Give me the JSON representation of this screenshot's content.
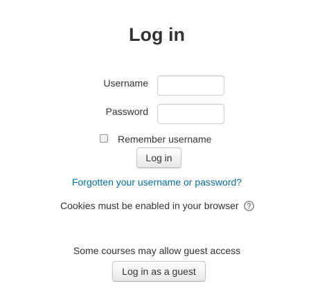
{
  "page": {
    "title": "Log in"
  },
  "login_form": {
    "username_label": "Username",
    "username_value": "",
    "password_label": "Password",
    "password_value": "",
    "remember_label": "Remember username",
    "remember_checked": false,
    "submit_label": "Log in",
    "forgot_link": "Forgotten your username or password?",
    "cookies_notice": "Cookies must be enabled in your browser",
    "help_icon": "question-circle-icon"
  },
  "guest": {
    "notice": "Some courses may allow guest access",
    "button_label": "Log in as a guest"
  },
  "colors": {
    "text": "#333333",
    "link": "#0070a8",
    "input_border": "#cccccc",
    "button_border": "#c4c4c4",
    "icon": "#888888"
  }
}
